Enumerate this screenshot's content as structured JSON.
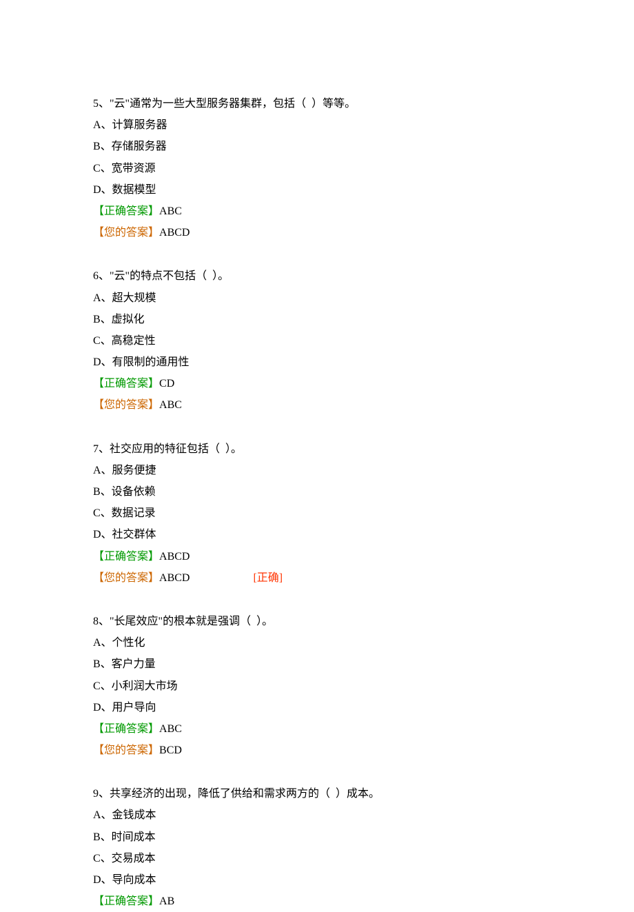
{
  "labels": {
    "correct": "【正确答案】",
    "yours": "【您的答案】",
    "statusCorrect": "[正确]"
  },
  "questions": [
    {
      "number": "5、",
      "stem": "\"云\"通常为一些大型服务器集群，包括（  ）等等。",
      "options": [
        "A、计算服务器",
        "B、存储服务器",
        "C、宽带资源",
        "D、数据模型"
      ],
      "correct": "ABC",
      "yours": "ABCD",
      "status": ""
    },
    {
      "number": "6、",
      "stem": "\"云\"的特点不包括（  ）。",
      "options": [
        "A、超大规模",
        "B、虚拟化",
        "C、高稳定性",
        "D、有限制的通用性"
      ],
      "correct": "CD",
      "yours": "ABC",
      "status": ""
    },
    {
      "number": "7、",
      "stem": "社交应用的特征包括（  ）。",
      "options": [
        "A、服务便捷",
        "B、设备依赖",
        "C、数据记录",
        "D、社交群体"
      ],
      "correct": "ABCD",
      "yours": "ABCD",
      "status": "[正确]"
    },
    {
      "number": "8、",
      "stem": "\"长尾效应\"的根本就是强调（  ）。",
      "options": [
        "A、个性化",
        "B、客户力量",
        "C、小利润大市场",
        "D、用户导向"
      ],
      "correct": "ABC",
      "yours": "BCD",
      "status": ""
    },
    {
      "number": "9、",
      "stem": "共享经济的出现，降低了供给和需求两方的（  ）成本。",
      "options": [
        "A、金钱成本",
        "B、时间成本",
        "C、交易成本",
        "D、导向成本"
      ],
      "correct": "AB",
      "yours": "",
      "status": ""
    }
  ]
}
